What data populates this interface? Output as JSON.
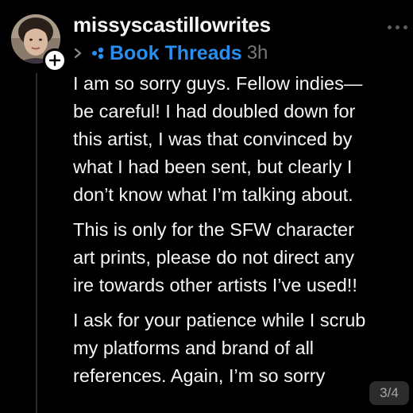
{
  "post": {
    "author": {
      "username": "missyscastillowrites",
      "avatar_icon": "profile-photo",
      "follow_icon": "plus-icon"
    },
    "meta": {
      "chevron_icon": "chevron-right-icon",
      "topic_icon": "topic-tag-icon",
      "topic": "Book Threads",
      "time": "3h"
    },
    "more_icon": "more-horizontal-icon",
    "paragraphs": [
      {
        "lines": [
          "I am so sorry guys. Fellow indies—",
          "be careful! I had doubled down for",
          "this artist, I was that convinced by",
          "what I had been sent, but clearly I",
          "don’t know what I’m talking about."
        ]
      },
      {
        "lines": [
          "This is only for the SFW character",
          "art prints, please do not direct any",
          "ire towards other artists I’ve used!!"
        ]
      },
      {
        "lines": [
          "I ask for your patience while I scrub",
          "my platforms and brand of all",
          "references. Again, I’m so sorry"
        ]
      }
    ],
    "page_indicator": "3/4",
    "colors": {
      "background": "#000000",
      "text": "#f3f5f7",
      "topic": "#2a8ef0",
      "muted": "#777777",
      "badge_bg": "#2c2c2c"
    }
  }
}
